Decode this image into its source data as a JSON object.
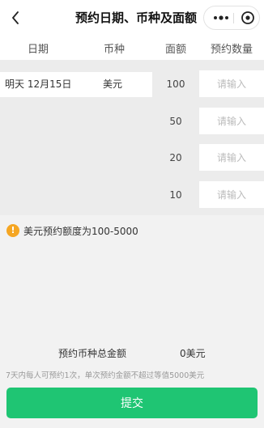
{
  "nav": {
    "title": "预约日期、币种及面额",
    "back_icon": "chevron-left-icon",
    "more_icon": "more-dots-icon",
    "close_icon": "target-circle-icon"
  },
  "table": {
    "headers": {
      "date": "日期",
      "currency": "币种",
      "denomination": "面额",
      "quantity": "预约数量"
    },
    "date_value": "明天 12月15日",
    "currency_value": "美元",
    "rows": [
      {
        "denomination": "100",
        "quantity": "",
        "placeholder": "请输入"
      },
      {
        "denomination": "50",
        "quantity": "",
        "placeholder": "请输入"
      },
      {
        "denomination": "20",
        "quantity": "",
        "placeholder": "请输入"
      },
      {
        "denomination": "10",
        "quantity": "",
        "placeholder": "请输入"
      }
    ]
  },
  "notice": {
    "icon": "!",
    "icon_name": "warning-icon",
    "color": "#f5a623",
    "text": "美元预约额度为100-5000"
  },
  "summary": {
    "total_label": "预约币种总金额",
    "total_value": "0美元"
  },
  "rule_text": "7天内每人可预约1次，单次预约金额不超过等值5000美元",
  "submit": {
    "label": "提交",
    "color": "#1fc573"
  }
}
